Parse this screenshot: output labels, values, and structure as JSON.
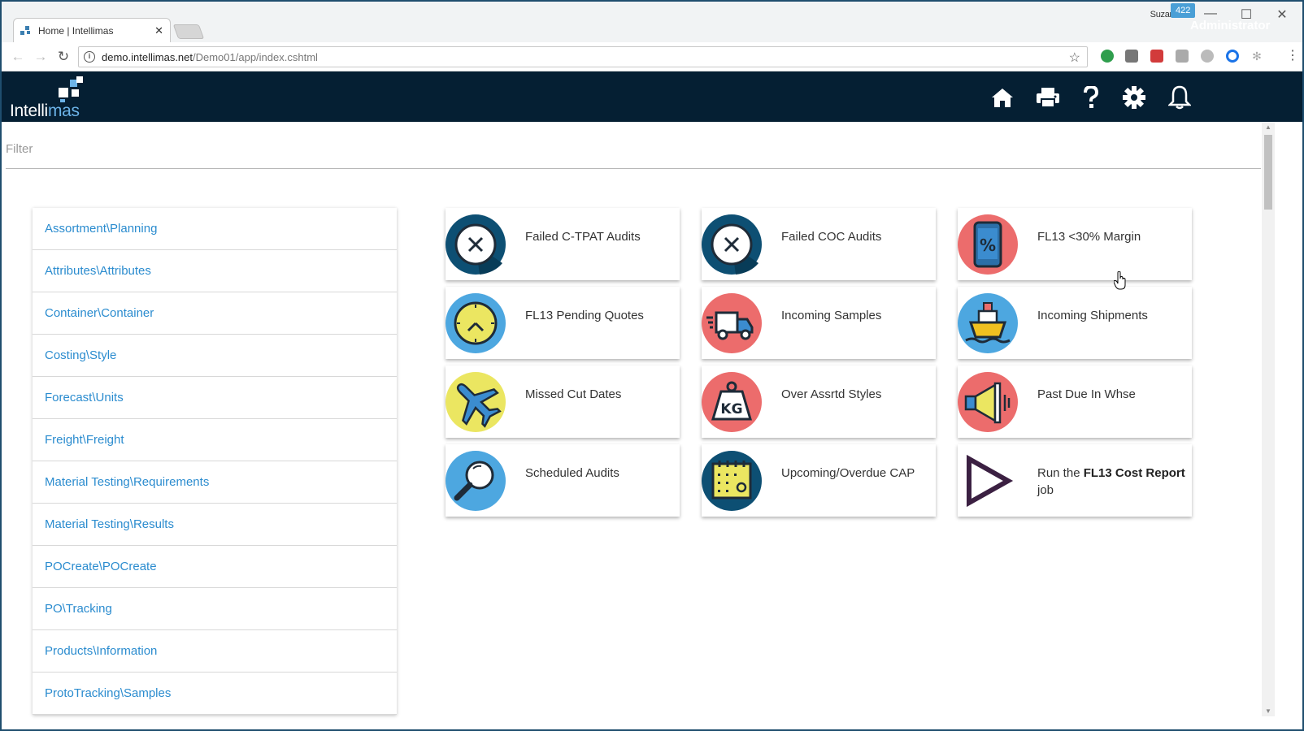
{
  "browser": {
    "tab_title": "Home | Intellimas",
    "tab_close": "✕",
    "user": "Suzanne",
    "url_host": "demo.intellimas.net",
    "url_path": "/Demo01/app/index.cshtml",
    "controls": {
      "minimize": "—",
      "maximize": "☐",
      "close": "✕"
    }
  },
  "app": {
    "logo_main": "Intelli",
    "logo_accent": "mas",
    "notification_count": "422",
    "user_menu": "Administrator",
    "header_icons": [
      "home-icon",
      "printer-icon",
      "help-icon",
      "gear-icon",
      "bell-icon"
    ]
  },
  "filter": {
    "placeholder": "Filter",
    "value": ""
  },
  "sidebar": {
    "items": [
      {
        "label": "Assortment\\Planning"
      },
      {
        "label": "Attributes\\Attributes"
      },
      {
        "label": "Container\\Container"
      },
      {
        "label": "Costing\\Style"
      },
      {
        "label": "Forecast\\Units"
      },
      {
        "label": "Freight\\Freight"
      },
      {
        "label": "Material Testing\\Requirements"
      },
      {
        "label": "Material Testing\\Results"
      },
      {
        "label": "POCreate\\POCreate"
      },
      {
        "label": "PO\\Tracking"
      },
      {
        "label": "Products\\Information"
      },
      {
        "label": "ProtoTracking\\Samples"
      }
    ]
  },
  "dashboard": {
    "cards": [
      {
        "label": "Failed C-TPAT Audits",
        "icon": "x-circle-icon",
        "color": "#0d4f73"
      },
      {
        "label": "Failed COC Audits",
        "icon": "x-circle-icon",
        "color": "#0d4f73"
      },
      {
        "label": "FL13 <30% Margin",
        "icon": "phone-percent-icon",
        "color": "#ec6c6c"
      },
      {
        "label": "FL13 Pending Quotes",
        "icon": "clock-icon",
        "color": "#4da7e0"
      },
      {
        "label": "Incoming Samples",
        "icon": "delivery-truck-icon",
        "color": "#ec6c6c"
      },
      {
        "label": "Incoming Shipments",
        "icon": "ship-icon",
        "color": "#4da7e0"
      },
      {
        "label": "Missed Cut Dates",
        "icon": "airplane-icon",
        "color": "#ebe661"
      },
      {
        "label": "Over Assrtd Styles",
        "icon": "kg-weight-icon",
        "color": "#ec6c6c"
      },
      {
        "label": "Past Due In Whse",
        "icon": "megaphone-icon",
        "color": "#ec6c6c"
      },
      {
        "label": "Scheduled Audits",
        "icon": "magnifier-icon",
        "color": "#4da7e0"
      },
      {
        "label": "Upcoming/Overdue CAP",
        "icon": "calendar-icon",
        "color": "#0d4f73"
      },
      {
        "label_prefix": "Run the ",
        "label_bold": "FL13 Cost Report",
        "label_suffix": "job",
        "icon": "play-icon",
        "color": "#3b2042"
      }
    ]
  }
}
